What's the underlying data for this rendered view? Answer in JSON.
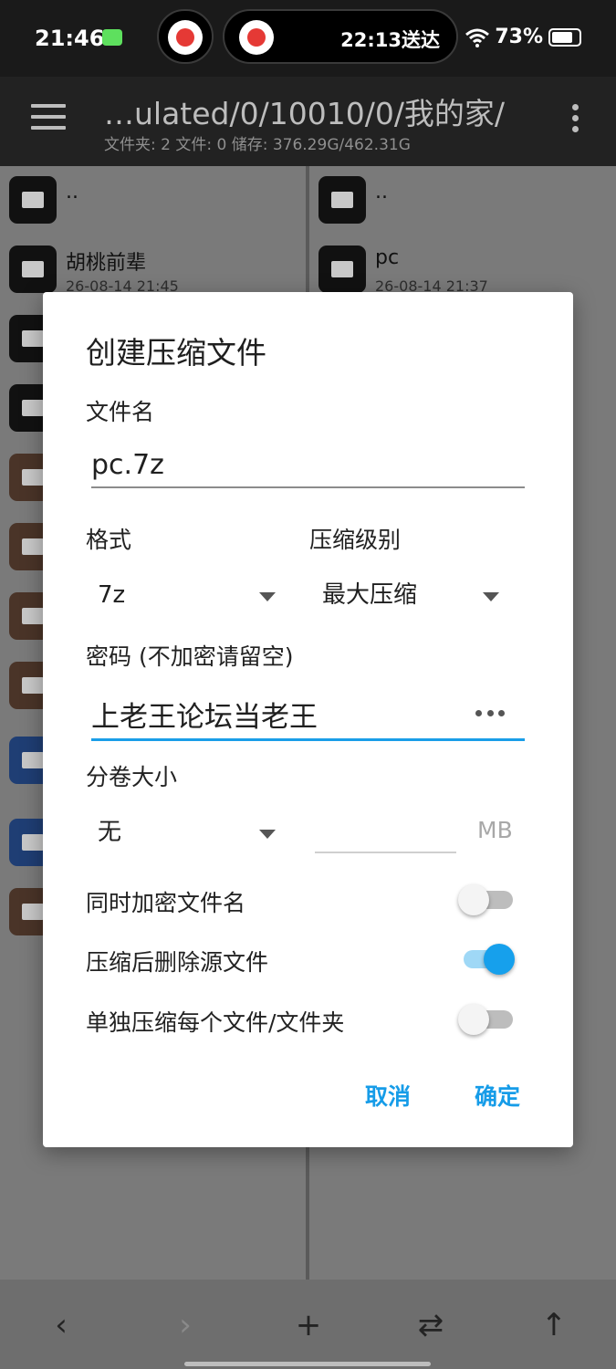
{
  "status_bar": {
    "time": "21:46",
    "live_activity": "22:13送达",
    "battery": "73%",
    "icons": [
      "vpn-key-icon",
      "delivery-avatar-icon",
      "wifi-icon",
      "battery-icon"
    ]
  },
  "toolbar": {
    "path": "…ulated/0/10010/0/我的家/",
    "summary": "文件夹: 2  文件: 0  储存: 376.29G/462.31G"
  },
  "left_pane": {
    "rows": [
      {
        "name": "..",
        "meta": ""
      },
      {
        "name": "胡桃前辈",
        "meta": "26-08-14 21:45"
      }
    ]
  },
  "right_pane": {
    "rows": [
      {
        "name": "..",
        "meta": ""
      },
      {
        "name": "pc",
        "meta": "26-08-14 21:37"
      }
    ]
  },
  "dialog": {
    "title": "创建压缩文件",
    "filename_label": "文件名",
    "filename_value": "pc.7z",
    "format_label": "格式",
    "format_value": "7z",
    "level_label": "压缩级别",
    "level_value": "最大压缩",
    "password_label": "密码 (不加密请留空)",
    "password_value": "上老王论坛当老王",
    "volume_label": "分卷大小",
    "volume_value": "无",
    "volume_size": "",
    "volume_unit": "MB",
    "encrypt_names_label": "同时加密文件名",
    "encrypt_names_on": false,
    "delete_source_label": "压缩后删除源文件",
    "delete_source_on": true,
    "separate_label": "单独压缩每个文件/文件夹",
    "separate_on": false,
    "cancel_label": "取消",
    "ok_label": "确定"
  },
  "bottom_bar": {
    "back": "‹",
    "forward": "›",
    "add": "+",
    "swap": "⇄",
    "up": "↑"
  },
  "colors": {
    "accent": "#169ce8",
    "switch_on": "#16a0ec"
  }
}
